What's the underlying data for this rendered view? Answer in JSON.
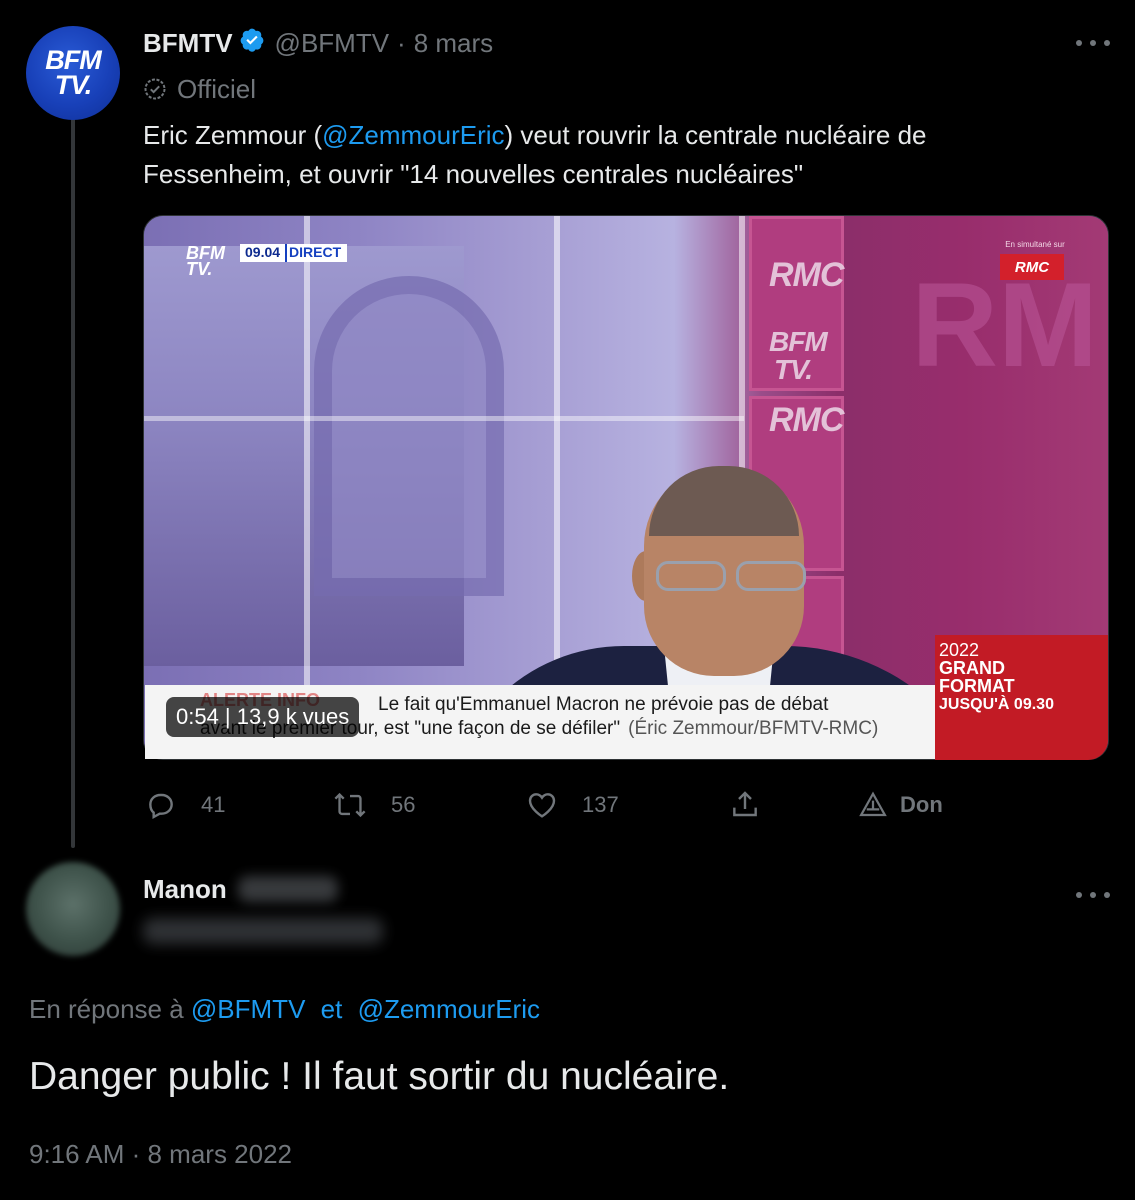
{
  "parent_tweet": {
    "author_name": "BFMTV",
    "handle": "@BFMTV",
    "separator": "·",
    "date": "8 mars",
    "avatar_text_line1": "BFM",
    "avatar_text_line2": "TV.",
    "label": "Officiel",
    "text_before": "Eric Zemmour (",
    "mention": "@ZemmourEric",
    "text_after": ") veut rouvrir la centrale nucléaire de Fessenheim, et ouvrir \"14 nouvelles centrales nucléaires\"",
    "video": {
      "overlay": "0:54 | 13,9 k vues",
      "bug_logo_1": "BFM",
      "bug_logo_2": "TV.",
      "bug_time": "09.04",
      "bug_direct": "DIRECT",
      "simulcast_label": "En simultané sur",
      "simulcast_badge": "RMC",
      "alert": "ALERTE INFO",
      "caption_line1": "Le fait qu'Emmanuel Macron ne prévoie pas de débat",
      "caption_line2": "avant le premier tour, est \"une façon de se défiler\"",
      "caption_source": "(Éric Zemmour/BFMTV-RMC)",
      "promo_year": "2022",
      "promo_title_1": "GRAND",
      "promo_title_2": "FORMAT",
      "promo_until": "JUSQU'À 09.30",
      "wall_text_1": "RMC",
      "wall_text_2": "BFM",
      "wall_text_3": "TV.",
      "wall_text_4": "RMC",
      "wall_big": "RM"
    },
    "actions": {
      "replies": "41",
      "retweets": "56",
      "likes": "137",
      "donate": "Don"
    }
  },
  "reply_tweet": {
    "author_first_name": "Manon",
    "in_reply_prefix": "En réponse à",
    "in_reply_mention_1": "@BFMTV",
    "in_reply_joiner": "et",
    "in_reply_mention_2": "@ZemmourEric",
    "text": "Danger public ! Il faut sortir du nucléaire.",
    "timestamp": "9:16 AM · 8 mars 2022"
  },
  "colors": {
    "background": "#000000",
    "text": "#e7e9ea",
    "secondary": "#71767b",
    "link": "#1d9bf0",
    "verified": "#1d9bf0"
  }
}
